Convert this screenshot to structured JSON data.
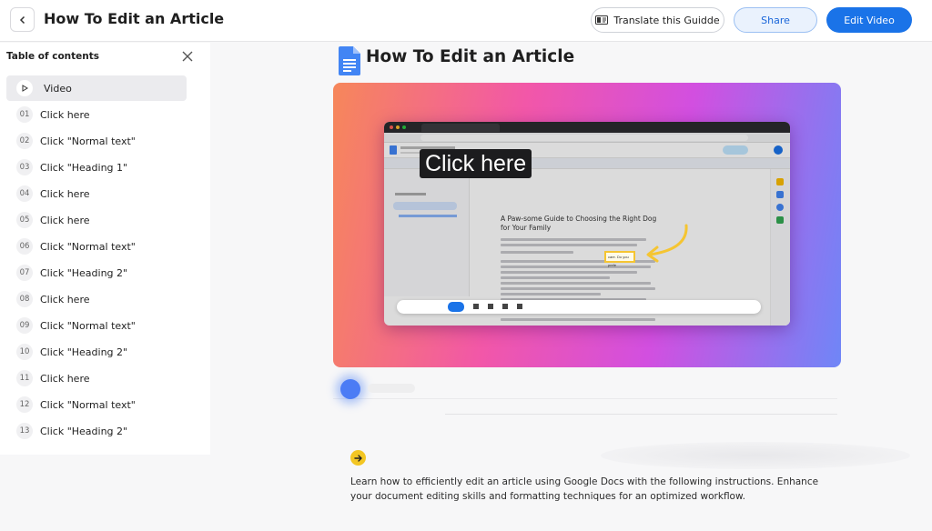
{
  "header": {
    "title": "How To Edit an Article",
    "translate_label": "Translate this Guidde",
    "share_label": "Share",
    "edit_label": "Edit Video"
  },
  "sidebar": {
    "title": "Table of contents",
    "items": [
      {
        "num": "",
        "label": "Video"
      },
      {
        "num": "01",
        "label": "Click here"
      },
      {
        "num": "02",
        "label": "Click \"Normal text\""
      },
      {
        "num": "03",
        "label": "Click \"Heading 1\""
      },
      {
        "num": "04",
        "label": "Click here"
      },
      {
        "num": "05",
        "label": "Click here"
      },
      {
        "num": "06",
        "label": "Click \"Normal text\""
      },
      {
        "num": "07",
        "label": "Click \"Heading 2\""
      },
      {
        "num": "08",
        "label": "Click here"
      },
      {
        "num": "09",
        "label": "Click \"Normal text\""
      },
      {
        "num": "10",
        "label": "Click \"Heading 2\""
      },
      {
        "num": "11",
        "label": "Click here"
      },
      {
        "num": "12",
        "label": "Click \"Normal text\""
      },
      {
        "num": "13",
        "label": "Click \"Heading 2\""
      }
    ]
  },
  "main": {
    "title": "How To Edit an Article",
    "video": {
      "callout": "Click here",
      "doc_heading": "A Paw-some Guide to Choosing the Right Dog for Your Family",
      "highlight_text": "care. Do you prefe"
    },
    "description": "Learn how to efficiently edit an article using Google Docs with the following instructions. Enhance your document editing skills and formatting techniques for an optimized workflow."
  },
  "colors": {
    "primary": "#1a73e8",
    "highlight": "#f5c532",
    "badge": "#f3c623"
  }
}
